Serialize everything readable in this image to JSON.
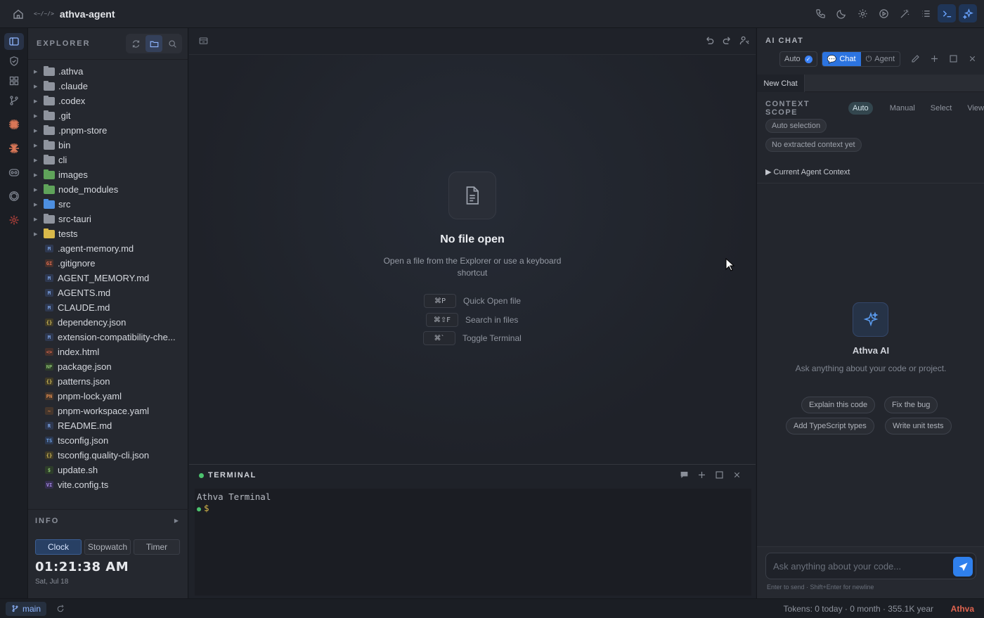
{
  "titlebar": {
    "logo_text": "<~/~/>",
    "title": "athva-agent",
    "icons": [
      "phone-icon",
      "moon-icon",
      "gear-icon",
      "play-icon",
      "magic-wand-icon",
      "list-icon",
      "terminal-icon",
      "sparkle-icon"
    ]
  },
  "activity_bar": {
    "items": [
      "explorer-icon",
      "shield-icon",
      "extensions-icon",
      "git-branch-icon",
      "claude-icon",
      "claude-icon-alt",
      "copilot-icon",
      "openai-icon",
      "sunburst-icon"
    ]
  },
  "explorer": {
    "title": "EXPLORER",
    "folders": [
      {
        "name": ".athva",
        "color": "#8f949e"
      },
      {
        "name": ".claude",
        "color": "#8f949e"
      },
      {
        "name": ".codex",
        "color": "#8f949e"
      },
      {
        "name": ".git",
        "color": "#8f949e"
      },
      {
        "name": ".pnpm-store",
        "color": "#8f949e"
      },
      {
        "name": "bin",
        "color": "#8f949e"
      },
      {
        "name": "cli",
        "color": "#8f949e"
      },
      {
        "name": "images",
        "color": "#5fa35a"
      },
      {
        "name": "node_modules",
        "color": "#5fa35a"
      },
      {
        "name": "src",
        "color": "#4d8fe0"
      },
      {
        "name": "src-tauri",
        "color": "#8f949e"
      },
      {
        "name": "tests",
        "color": "#d9b94a"
      }
    ],
    "files": [
      {
        "name": ".agent-memory.md",
        "badge": "M",
        "kind": "md"
      },
      {
        "name": ".gitignore",
        "badge": "GI",
        "kind": "git"
      },
      {
        "name": "AGENT_MEMORY.md",
        "badge": "M",
        "kind": "md"
      },
      {
        "name": "AGENTS.md",
        "badge": "M",
        "kind": "md"
      },
      {
        "name": "CLAUDE.md",
        "badge": "M",
        "kind": "md"
      },
      {
        "name": "dependency.json",
        "badge": "{}",
        "kind": "json"
      },
      {
        "name": "extension-compatibility-che...",
        "badge": "M",
        "kind": "md"
      },
      {
        "name": "index.html",
        "badge": "<>",
        "kind": "html"
      },
      {
        "name": "package.json",
        "badge": "NP",
        "kind": "npm"
      },
      {
        "name": "patterns.json",
        "badge": "{}",
        "kind": "json"
      },
      {
        "name": "pnpm-lock.yaml",
        "badge": "PN",
        "kind": "yaml"
      },
      {
        "name": "pnpm-workspace.yaml",
        "badge": "~",
        "kind": "yaml"
      },
      {
        "name": "README.md",
        "badge": "R",
        "kind": "r"
      },
      {
        "name": "tsconfig.json",
        "badge": "TS",
        "kind": "ts"
      },
      {
        "name": "tsconfig.quality-cli.json",
        "badge": "{}",
        "kind": "json"
      },
      {
        "name": "update.sh",
        "badge": "$",
        "kind": "sh"
      },
      {
        "name": "vite.config.ts",
        "badge": "VI",
        "kind": "vite"
      }
    ]
  },
  "info": {
    "title": "INFO",
    "tabs": [
      "Clock",
      "Stopwatch",
      "Timer"
    ],
    "active_tab": "Clock",
    "time": "01:21:38 AM",
    "date": "Sat, Jul 18"
  },
  "editor": {
    "empty_title": "No file open",
    "empty_subtitle": "Open a file from the Explorer or use a keyboard shortcut",
    "shortcuts": [
      {
        "keys": "⌘P",
        "label": "Quick Open file"
      },
      {
        "keys": "⌘⇧F",
        "label": "Search in files"
      },
      {
        "keys": "⌘`",
        "label": "Toggle Terminal"
      }
    ]
  },
  "terminal": {
    "title": "TERMINAL",
    "line1": "Athva Terminal",
    "line2_dot": "●",
    "line2_prompt": "$"
  },
  "chat": {
    "title": "AI CHAT",
    "auto_label": "Auto",
    "modes": [
      "Chat",
      "Agent"
    ],
    "active_mode": "Chat",
    "tab": "New Chat",
    "context_scope_label": "CONTEXT SCOPE",
    "context_options": [
      "Auto",
      "Manual",
      "Select",
      "View"
    ],
    "active_context": "Auto",
    "auto_selection": "Auto selection",
    "no_context": "No extracted context yet",
    "agent_context": "▶ Current Agent Context",
    "ai_title": "Athva AI",
    "ai_subtitle": "Ask anything about your code or project.",
    "suggestions": [
      "Explain this code",
      "Fix the bug",
      "Add TypeScript types",
      "Write unit tests"
    ],
    "input_placeholder": "Ask anything about your code...",
    "input_hint": "Enter to send · Shift+Enter for newline"
  },
  "statusbar": {
    "branch": "main",
    "tokens": "Tokens: 0 today · 0 month · 355.1K year",
    "brand": "Athva"
  },
  "colors": {
    "accent": "#2f80ed",
    "brand": "#e0644f",
    "terminal_ok": "#4cc36e"
  }
}
